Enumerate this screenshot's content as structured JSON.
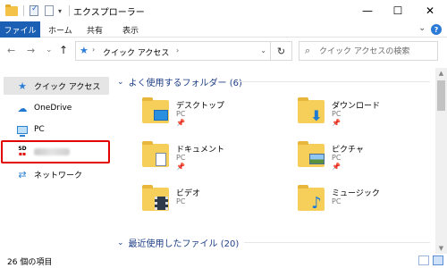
{
  "window": {
    "title": "エクスプローラー",
    "minimize": "—",
    "maximize": "☐",
    "close": "✕"
  },
  "ribbon": {
    "tabs": [
      "ファイル",
      "ホーム",
      "共有",
      "表示"
    ],
    "expand_icon": "⌄",
    "help_label": "?"
  },
  "nav": {
    "back": "←",
    "forward": "→",
    "recent": "⌄",
    "up": "↑"
  },
  "address": {
    "location": "クイック アクセス",
    "separator": "›",
    "dropdown": "⌄",
    "refresh": "↻"
  },
  "search": {
    "placeholder": "クイック アクセスの検索"
  },
  "sidebar": {
    "items": [
      {
        "label": "クイック アクセス",
        "icon": "star-icon",
        "selected": true
      },
      {
        "label": "OneDrive",
        "icon": "cloud-icon"
      },
      {
        "label": "PC",
        "icon": "pc-icon"
      },
      {
        "label": "",
        "icon": "sd-card-icon",
        "blurred": true,
        "highlighted": true
      },
      {
        "label": "ネットワーク",
        "icon": "network-icon"
      }
    ]
  },
  "groups": {
    "frequent": "よく使用するフォルダー (6)",
    "recent": "最近使用したファイル (20)"
  },
  "folders": [
    {
      "name": "デスクトップ",
      "location": "PC",
      "pinned": true,
      "icon": "desktop-folder-icon"
    },
    {
      "name": "ダウンロード",
      "location": "PC",
      "pinned": true,
      "icon": "downloads-folder-icon"
    },
    {
      "name": "ドキュメント",
      "location": "PC",
      "pinned": true,
      "icon": "documents-folder-icon"
    },
    {
      "name": "ピクチャ",
      "location": "PC",
      "pinned": true,
      "icon": "pictures-folder-icon"
    },
    {
      "name": "ビデオ",
      "location": "PC",
      "pinned": false,
      "icon": "videos-folder-icon"
    },
    {
      "name": "ミュージック",
      "location": "PC",
      "pinned": false,
      "icon": "music-folder-icon"
    }
  ],
  "pin_glyph": "📌",
  "status": {
    "item_count": "26 個の項目"
  },
  "colors": {
    "accent": "#1a5fb4",
    "folder": "#f6cf5a",
    "highlight": "#e00000"
  }
}
